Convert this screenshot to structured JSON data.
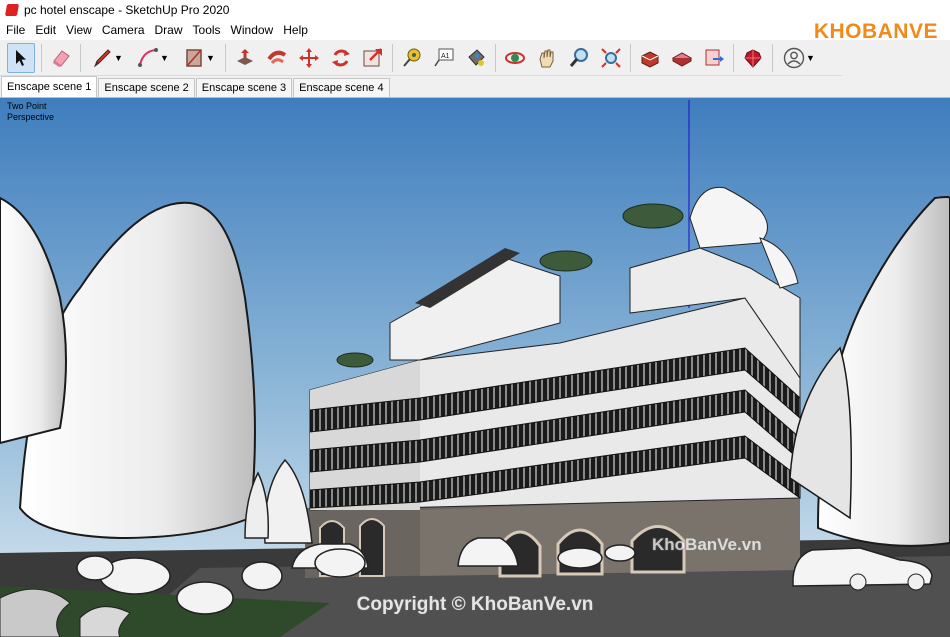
{
  "window": {
    "title": "pc hotel enscape - SketchUp Pro 2020"
  },
  "menu": [
    "File",
    "Edit",
    "View",
    "Camera",
    "Draw",
    "Tools",
    "Window",
    "Help"
  ],
  "tools": [
    {
      "name": "select-icon"
    },
    {
      "name": "eraser-icon"
    },
    {
      "name": "pencil-line-icon"
    },
    {
      "name": "arc-icon"
    },
    {
      "name": "rectangle-icon"
    },
    {
      "name": "push-pull-icon"
    },
    {
      "name": "follow-me-icon"
    },
    {
      "name": "move-icon"
    },
    {
      "name": "rotate-icon"
    },
    {
      "name": "scale-icon"
    },
    {
      "name": "tape-measure-icon"
    },
    {
      "name": "text-icon"
    },
    {
      "name": "paint-bucket-icon"
    },
    {
      "name": "orbit-icon"
    },
    {
      "name": "pan-icon"
    },
    {
      "name": "zoom-icon"
    },
    {
      "name": "zoom-extents-icon"
    },
    {
      "name": "3d-warehouse-icon"
    },
    {
      "name": "extension-warehouse-icon"
    },
    {
      "name": "layout-send-icon"
    },
    {
      "name": "ruby-console-icon"
    },
    {
      "name": "account-icon"
    }
  ],
  "text_tool_label": "A1",
  "scene_tabs": [
    "Enscape scene 1",
    "Enscape scene 2",
    "Enscape scene 3",
    "Enscape scene 4"
  ],
  "active_scene": "Enscape scene 1",
  "viewport": {
    "camera_label_line1": "Two Point",
    "camera_label_line2": "Perspective"
  },
  "logo": {
    "text": "KHOBANVE"
  },
  "watermark_center": "Copyright © KhoBanVe.vn",
  "watermark_right": "KhoBanVe.vn",
  "colors": {
    "sky_top": "#4a84c2",
    "sky_bottom": "#d8e6f0",
    "accent_select": "#cfe3f7",
    "logo": "#f28a1a"
  }
}
